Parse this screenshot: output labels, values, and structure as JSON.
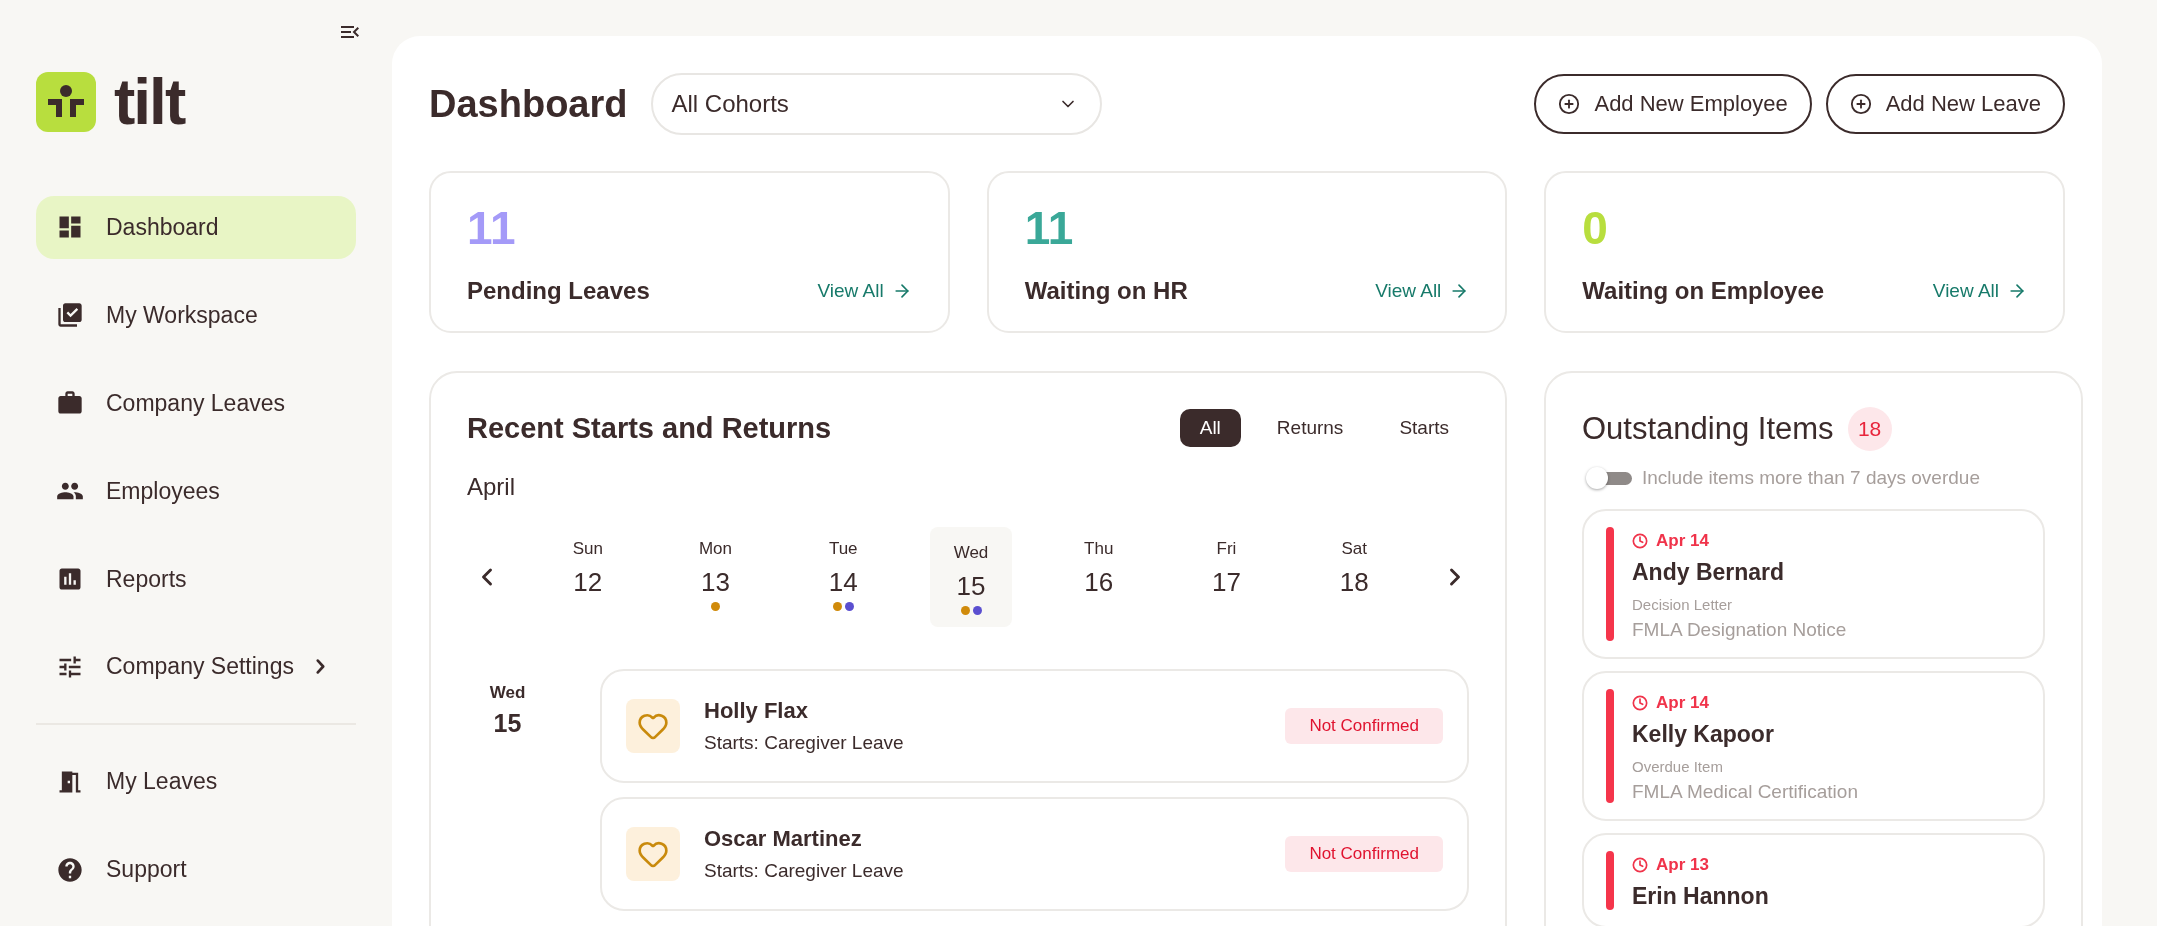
{
  "logo": {
    "text": "tilt"
  },
  "sidebar": {
    "items": [
      {
        "label": "Dashboard",
        "selected": true
      },
      {
        "label": "My Workspace",
        "selected": false
      },
      {
        "label": "Company Leaves",
        "selected": false
      },
      {
        "label": "Employees",
        "selected": false
      },
      {
        "label": "Reports",
        "selected": false
      },
      {
        "label": "Company Settings",
        "selected": false,
        "has_submenu": true
      }
    ],
    "bottom_items": [
      {
        "label": "My Leaves",
        "selected": false
      },
      {
        "label": "Support",
        "selected": false
      }
    ]
  },
  "header": {
    "title": "Dashboard",
    "cohort_select": {
      "value": "All Cohorts"
    },
    "buttons": [
      "Add New Employee",
      "Add New Leave"
    ]
  },
  "stats": [
    {
      "count": "11",
      "label": "Pending Leaves",
      "link": "View All",
      "color": "#a49af8"
    },
    {
      "count": "11",
      "label": "Waiting on HR",
      "link": "View All",
      "color": "#3aa898"
    },
    {
      "count": "0",
      "label": "Waiting on Employee",
      "link": "View All",
      "color": "#b8de3e"
    }
  ],
  "recent": {
    "title": "Recent Starts and Returns",
    "filters": [
      {
        "label": "All",
        "selected": true
      },
      {
        "label": "Returns",
        "selected": false
      },
      {
        "label": "Starts",
        "selected": false
      }
    ],
    "month": "April",
    "days": [
      {
        "weekday": "Sun",
        "date": "12",
        "selected": false
      },
      {
        "weekday": "Mon",
        "date": "13",
        "selected": false,
        "dots": [
          {
            "color": "#d08a0a"
          }
        ]
      },
      {
        "weekday": "Tue",
        "date": "14",
        "selected": false,
        "dots": [
          {
            "color": "#d08a0a"
          },
          {
            "color": "#5b4fd0"
          }
        ]
      },
      {
        "weekday": "Wed",
        "date": "15",
        "selected": true,
        "dots": [
          {
            "color": "#d08a0a"
          },
          {
            "color": "#5b4fd0"
          }
        ]
      },
      {
        "weekday": "Thu",
        "date": "16",
        "selected": false
      },
      {
        "weekday": "Fri",
        "date": "17",
        "selected": false
      },
      {
        "weekday": "Sat",
        "date": "18",
        "selected": false
      }
    ],
    "group": {
      "weekday": "Wed",
      "date": "15"
    },
    "entries": [
      {
        "name": "Holly Flax",
        "detail": "Starts: Caregiver Leave",
        "status": "Not Confirmed"
      },
      {
        "name": "Oscar Martinez",
        "detail": "Starts: Caregiver Leave",
        "status": "Not Confirmed"
      }
    ]
  },
  "outstanding": {
    "title": "Outstanding Items",
    "count": "18",
    "toggle": {
      "label": "Include items more than 7 days overdue",
      "on": false
    },
    "items": [
      {
        "date": "Apr 14",
        "name": "Andy Bernard",
        "type": "Decision Letter",
        "document": "FMLA Designation Notice"
      },
      {
        "date": "Apr 14",
        "name": "Kelly Kapoor",
        "type": "Overdue Item",
        "document": "FMLA Medical Certification"
      },
      {
        "date": "Apr 13",
        "name": "Erin Hannon"
      }
    ]
  }
}
